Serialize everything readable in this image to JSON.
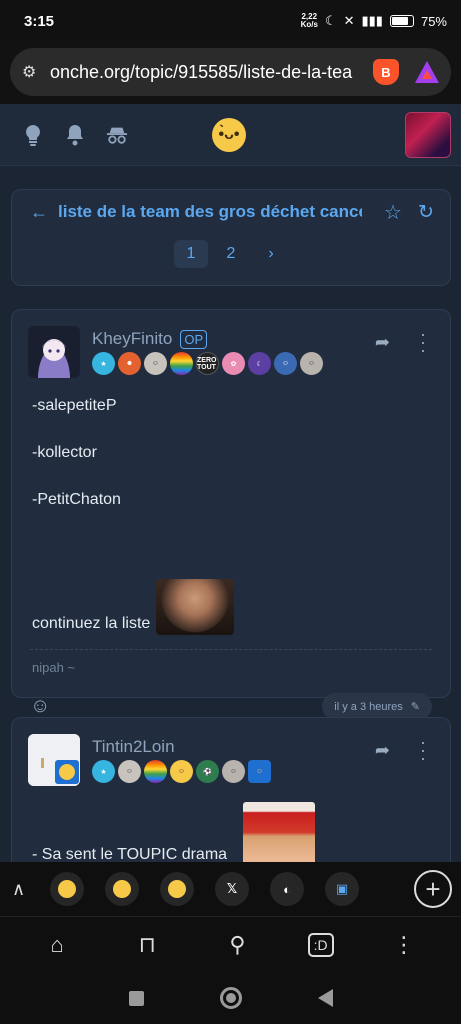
{
  "status_bar": {
    "time": "3:15",
    "net_speed_value": "2,22",
    "net_speed_unit": "Ko/s",
    "battery": "75%"
  },
  "browser": {
    "url": "onche.org/topic/915585/liste-de-la-tea"
  },
  "topic": {
    "title": "liste de la team des gros déchet cancer",
    "pages": [
      "1",
      "2"
    ],
    "current_page": "1"
  },
  "posts": [
    {
      "author": "KheyFinito",
      "op_badge": "OP",
      "lines": [
        "-salepetiteP",
        "-kollector",
        "-PetitChaton"
      ],
      "last_line": "continuez la liste",
      "signature": "nipah ~",
      "time": "il y a 3 heures"
    },
    {
      "author": "Tintin2Loin",
      "text": "- Sa sent le TOUPIC drama"
    }
  ],
  "badge_texts": {
    "zero_tout": "ZERO TOUT"
  },
  "colors": {
    "accent": "#5ba7f0",
    "background": "#1b2533",
    "card": "#212d3e"
  }
}
